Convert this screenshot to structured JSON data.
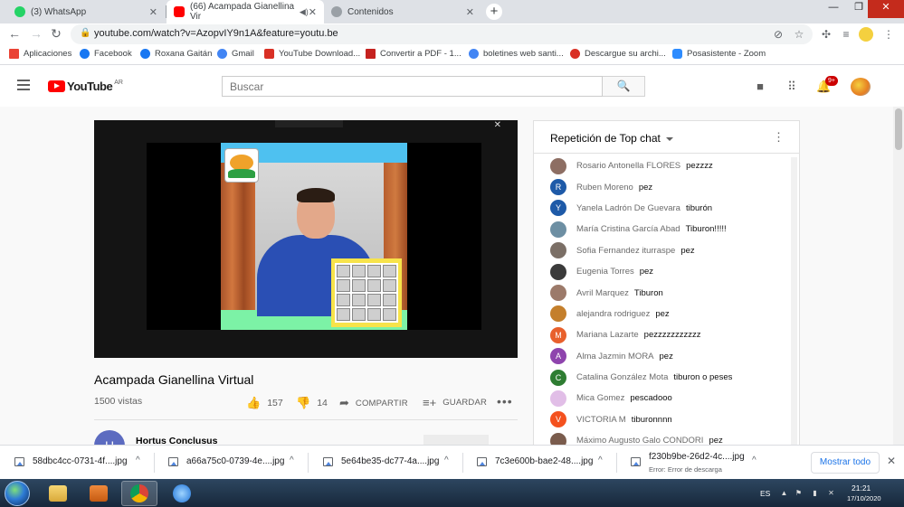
{
  "browser": {
    "tabs": [
      {
        "label": "(3) WhatsApp",
        "color": "#25d366",
        "badge": "3"
      },
      {
        "label": "(66) Acampada Gianellina Vir",
        "color": "#ff0000",
        "active": true
      },
      {
        "label": "Contenidos",
        "color": "#9aa0a6"
      }
    ],
    "new_tab": "+",
    "url": "youtube.com/watch?v=AzopvIY9n1A&feature=youtu.be",
    "bookmarks": [
      {
        "label": "Aplicaciones",
        "color": "#ea4335"
      },
      {
        "label": "Facebook",
        "color": "#1877f2"
      },
      {
        "label": "Roxana Gaitán",
        "color": "#1877f2"
      },
      {
        "label": "Gmail",
        "color": "#4285f4"
      },
      {
        "label": "YouTube Download...",
        "color": "#d93025"
      },
      {
        "label": "Convertir a PDF - 1...",
        "color": "#c5221f"
      },
      {
        "label": "boletines web santi...",
        "color": "#4285f4"
      },
      {
        "label": "Descargue su archi...",
        "color": "#d93025"
      },
      {
        "label": "Posasistente - Zoom",
        "color": "#2d8cff"
      }
    ]
  },
  "youtube": {
    "logo_text": "YouTube",
    "country": "AR",
    "search_placeholder": "Buscar",
    "notifications": "9+"
  },
  "video": {
    "title": "Acampada Gianellina Virtual",
    "views": "1500 vistas",
    "likes": "157",
    "dislikes": "14",
    "share_label": "COMPARTIR",
    "save_label": "GUARDAR",
    "channel_initial": "H",
    "channel_name": "Hortus Conclusus"
  },
  "chat": {
    "title": "Repetición de Top chat",
    "messages": [
      {
        "initial": "",
        "color": "#8d6e63",
        "author": "Rosario Antonella FLORES",
        "text": "pezzzz"
      },
      {
        "initial": "R",
        "color": "#1e5aa8",
        "author": "Ruben Moreno",
        "text": "pez"
      },
      {
        "initial": "Y",
        "color": "#1e5aa8",
        "author": "Yanela Ladrón De Guevara",
        "text": "tiburón"
      },
      {
        "initial": "",
        "color": "#6d8fa3",
        "author": "María Cristina García Abad",
        "text": "Tiburon!!!!!"
      },
      {
        "initial": "",
        "color": "#7b6f66",
        "author": "Sofia Fernandez iturraspe",
        "text": "pez"
      },
      {
        "initial": "",
        "color": "#3b3b3b",
        "author": "Eugenia Torres",
        "text": "pez"
      },
      {
        "initial": "",
        "color": "#9c7a6a",
        "author": "Avril Marquez",
        "text": "Tiburon"
      },
      {
        "initial": "",
        "color": "#c47f2c",
        "author": "alejandra rodriguez",
        "text": "pez"
      },
      {
        "initial": "M",
        "color": "#e8602c",
        "author": "Mariana Lazarte",
        "text": "pezzzzzzzzzzz"
      },
      {
        "initial": "A",
        "color": "#8e44ad",
        "author": "Alma Jazmin MORA",
        "text": "pez"
      },
      {
        "initial": "C",
        "color": "#2e7d32",
        "author": "Catalina González Mota",
        "text": "tiburon o peses"
      },
      {
        "initial": "",
        "color": "#e1bee7",
        "author": "Mica Gomez",
        "text": "pescadooo"
      },
      {
        "initial": "V",
        "color": "#f4511e",
        "author": "VICTORIA M",
        "text": "tiburonnnn"
      },
      {
        "initial": "",
        "color": "#7a5c4d",
        "author": "Máximo Augusto Galo CONDORI",
        "text": "pez"
      }
    ]
  },
  "downloads": {
    "items": [
      {
        "name": "58dbc4cc-0731-4f....jpg",
        "status": ""
      },
      {
        "name": "a66a75c0-0739-4e....jpg",
        "status": ""
      },
      {
        "name": "5e64be35-dc77-4a....jpg",
        "status": ""
      },
      {
        "name": "7c3e600b-bae2-48....jpg",
        "status": ""
      },
      {
        "name": "f230b9be-26d2-4c....jpg",
        "status": "Error: Error de descarga"
      }
    ],
    "show_all": "Mostrar todo"
  },
  "taskbar": {
    "language": "ES",
    "time": "21:21",
    "date": "17/10/2020"
  }
}
